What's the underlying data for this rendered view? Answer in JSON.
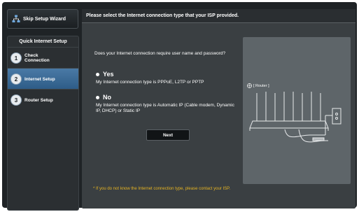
{
  "sidebar": {
    "skip_label": "Skip Setup Wizard",
    "section_title": "Quick Internet Setup",
    "steps": [
      {
        "num": "1",
        "label_line1": "Check",
        "label_line2": "Connection"
      },
      {
        "num": "2",
        "label_line1": "Internet Setup",
        "label_line2": ""
      },
      {
        "num": "3",
        "label_line1": "Router Setup",
        "label_line2": ""
      }
    ]
  },
  "main": {
    "header": "Please select the Internet connection type that your ISP provided.",
    "question": "Does your Internet connection require user name and password?",
    "options": [
      {
        "head": "Yes",
        "desc": "My Internet connection type is PPPoE, L2TP or PPTP"
      },
      {
        "head": "No",
        "desc": "My Internet connection type is Automatic IP (Cable modem, Dynamic IP, DHCP) or Static IP"
      }
    ],
    "next_label": "Next",
    "illustration_label": "[ Router ]",
    "note": "* If you do not know the Internet connection type, please contact your ISP."
  },
  "colors": {
    "active_step": "#3d6d99",
    "note": "#e6b422",
    "panel": "#3a3f42"
  }
}
